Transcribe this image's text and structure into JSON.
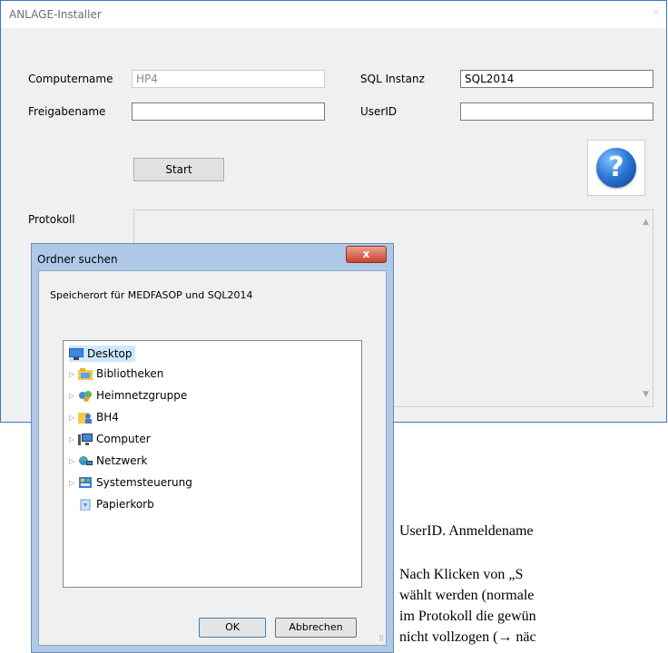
{
  "installer": {
    "title": "ANLAGE-Installer",
    "computername_label": "Computername",
    "computername_value": "HP4",
    "freigabename_label": "Freigabename",
    "freigabename_value": "",
    "sql_instanz_label": "SQL Instanz",
    "sql_instanz_value": "SQL2014",
    "userid_label": "UserID",
    "userid_value": "",
    "start_label": "Start",
    "help_glyph": "?",
    "protokoll_label": "Protokoll"
  },
  "dialog": {
    "title": "Ordner suchen",
    "close_glyph": "x",
    "description": "Speicherort für MEDFASOP und SQL2014",
    "tree": [
      {
        "label": "Desktop",
        "icon": "desktop-icon",
        "expandable": false,
        "selected": true
      },
      {
        "label": "Bibliotheken",
        "icon": "libraries-icon",
        "expandable": true
      },
      {
        "label": "Heimnetzgruppe",
        "icon": "homegroup-icon",
        "expandable": true
      },
      {
        "label": "BH4",
        "icon": "user-folder-icon",
        "expandable": true
      },
      {
        "label": "Computer",
        "icon": "computer-icon",
        "expandable": true
      },
      {
        "label": "Netzwerk",
        "icon": "network-icon",
        "expandable": true
      },
      {
        "label": "Systemsteuerung",
        "icon": "control-panel-icon",
        "expandable": true
      },
      {
        "label": "Papierkorb",
        "icon": "recycle-bin-icon",
        "expandable": false
      }
    ],
    "ok_label": "OK",
    "cancel_label": "Abbrechen"
  },
  "document": {
    "line1": "UserID. Anmeldename",
    "line2": "Nach Klicken von „S",
    "line3": "wählt werden (normale",
    "line4": "im Protokoll die gewün",
    "line5": "nicht vollzogen (→ näc"
  },
  "colors": {
    "window_border": "#3b78c8",
    "help_blue": "#2d7ad8",
    "selection": "#cce8ff",
    "close_red": "#c8442c"
  }
}
